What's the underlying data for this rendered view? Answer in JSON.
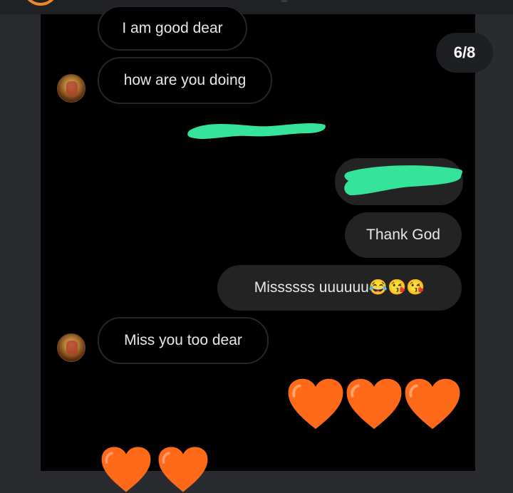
{
  "viewer": {
    "counter": "6/8"
  },
  "messages": [
    {
      "text": "I am good dear",
      "side": "incoming"
    },
    {
      "text": "how are you doing",
      "side": "incoming"
    },
    {
      "text": "Thank God",
      "side": "outgoing"
    },
    {
      "text": "Missssss uuuuuu😂😘😘",
      "side": "outgoing"
    },
    {
      "text": "Miss you too dear",
      "side": "incoming"
    }
  ],
  "reactions": {
    "row1": [
      "orange-heart-icon",
      "orange-heart-icon",
      "orange-heart-icon"
    ],
    "row2": [
      "orange-heart-icon",
      "orange-heart-icon"
    ]
  },
  "colors": {
    "heart_orange": "#ff6a1a",
    "redaction_green": "#35e39a",
    "accent_orange": "#f08a24"
  }
}
